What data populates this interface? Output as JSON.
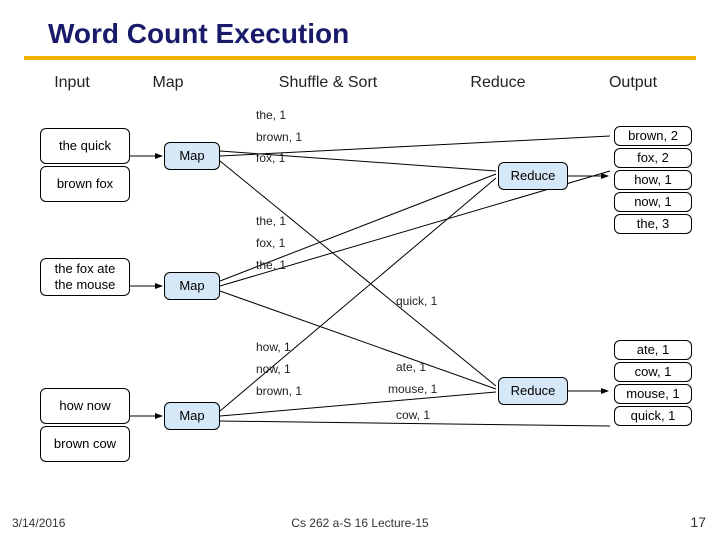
{
  "title": "Word Count Execution",
  "headers": {
    "input": "Input",
    "map": "Map",
    "shuffle": "Shuffle & Sort",
    "reduce": "Reduce",
    "output": "Output"
  },
  "inputs": {
    "a1": "the quick",
    "a2": "brown fox",
    "b1": "the fox ate",
    "b2": "the mouse",
    "c1": "how now",
    "c2": "brown cow"
  },
  "map_label": "Map",
  "reduce_label": "Reduce",
  "emits": {
    "m1_a": "the, 1",
    "m1_b": "brown, 1",
    "m1_c": "fox, 1",
    "m2_a": "the, 1",
    "m2_b": "fox, 1",
    "m2_c": "the, 1",
    "m3_a": "how, 1",
    "m3_b": "now, 1",
    "m3_c": "brown, 1"
  },
  "shuffle": {
    "quick": "quick, 1",
    "ate": "ate, 1",
    "mouse": "mouse, 1",
    "cow": "cow, 1"
  },
  "outputs": {
    "r1a": "brown, 2",
    "r1b": "fox, 2",
    "r1c": "how, 1",
    "r1d": "now, 1",
    "r1e": "the, 3",
    "r2a": "ate, 1",
    "r2b": "cow, 1",
    "r2c": "mouse, 1",
    "r2d": "quick, 1"
  },
  "footer": {
    "date": "3/14/2016",
    "center": "Cs 262 a-S 16 Lecture-15",
    "page": "17"
  }
}
